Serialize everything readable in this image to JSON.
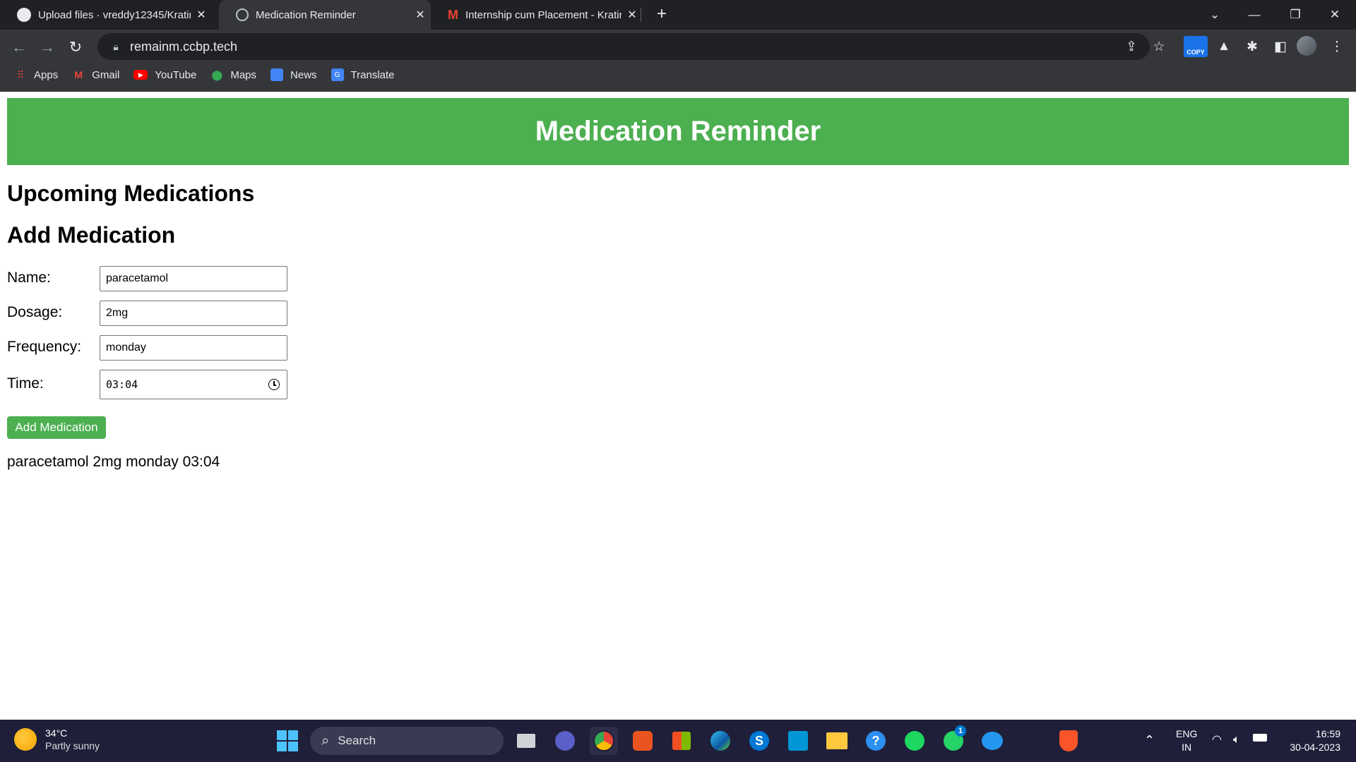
{
  "browser": {
    "tabs": [
      {
        "title": "Upload files · vreddy12345/Kratin",
        "icon": "github-icon",
        "active": false
      },
      {
        "title": "Medication Reminder",
        "icon": "globe-icon",
        "active": true
      },
      {
        "title": "Internship cum Placement - Kratin",
        "icon": "gmail-icon",
        "active": false
      }
    ],
    "url": "remainm.ccbp.tech",
    "copy_extension_label": "COPY",
    "bookmarks": [
      {
        "label": "Apps",
        "icon": "apps-grid-icon"
      },
      {
        "label": "Gmail",
        "icon": "gmail-icon"
      },
      {
        "label": "YouTube",
        "icon": "youtube-icon"
      },
      {
        "label": "Maps",
        "icon": "maps-pin-icon"
      },
      {
        "label": "News",
        "icon": "news-icon"
      },
      {
        "label": "Translate",
        "icon": "translate-icon"
      }
    ]
  },
  "app": {
    "title": "Medication Reminder",
    "upcoming_heading": "Upcoming Medications",
    "add_heading": "Add Medication",
    "form": {
      "name_label": "Name:",
      "name_value": "paracetamol",
      "dosage_label": "Dosage:",
      "dosage_value": "2mg",
      "frequency_label": "Frequency:",
      "frequency_value": "monday",
      "time_label": "Time:",
      "time_value": "03:04"
    },
    "add_button_label": "Add Medication",
    "medications": [
      "paracetamol 2mg monday 03:04"
    ],
    "accent_color": "#4caf50"
  },
  "taskbar": {
    "weather_temp": "34°C",
    "weather_condition": "Partly sunny",
    "search_label": "Search",
    "language_line1": "ENG",
    "language_line2": "IN",
    "clock_time": "16:59",
    "clock_date": "30-04-2023",
    "whatsapp_badge": "1"
  }
}
